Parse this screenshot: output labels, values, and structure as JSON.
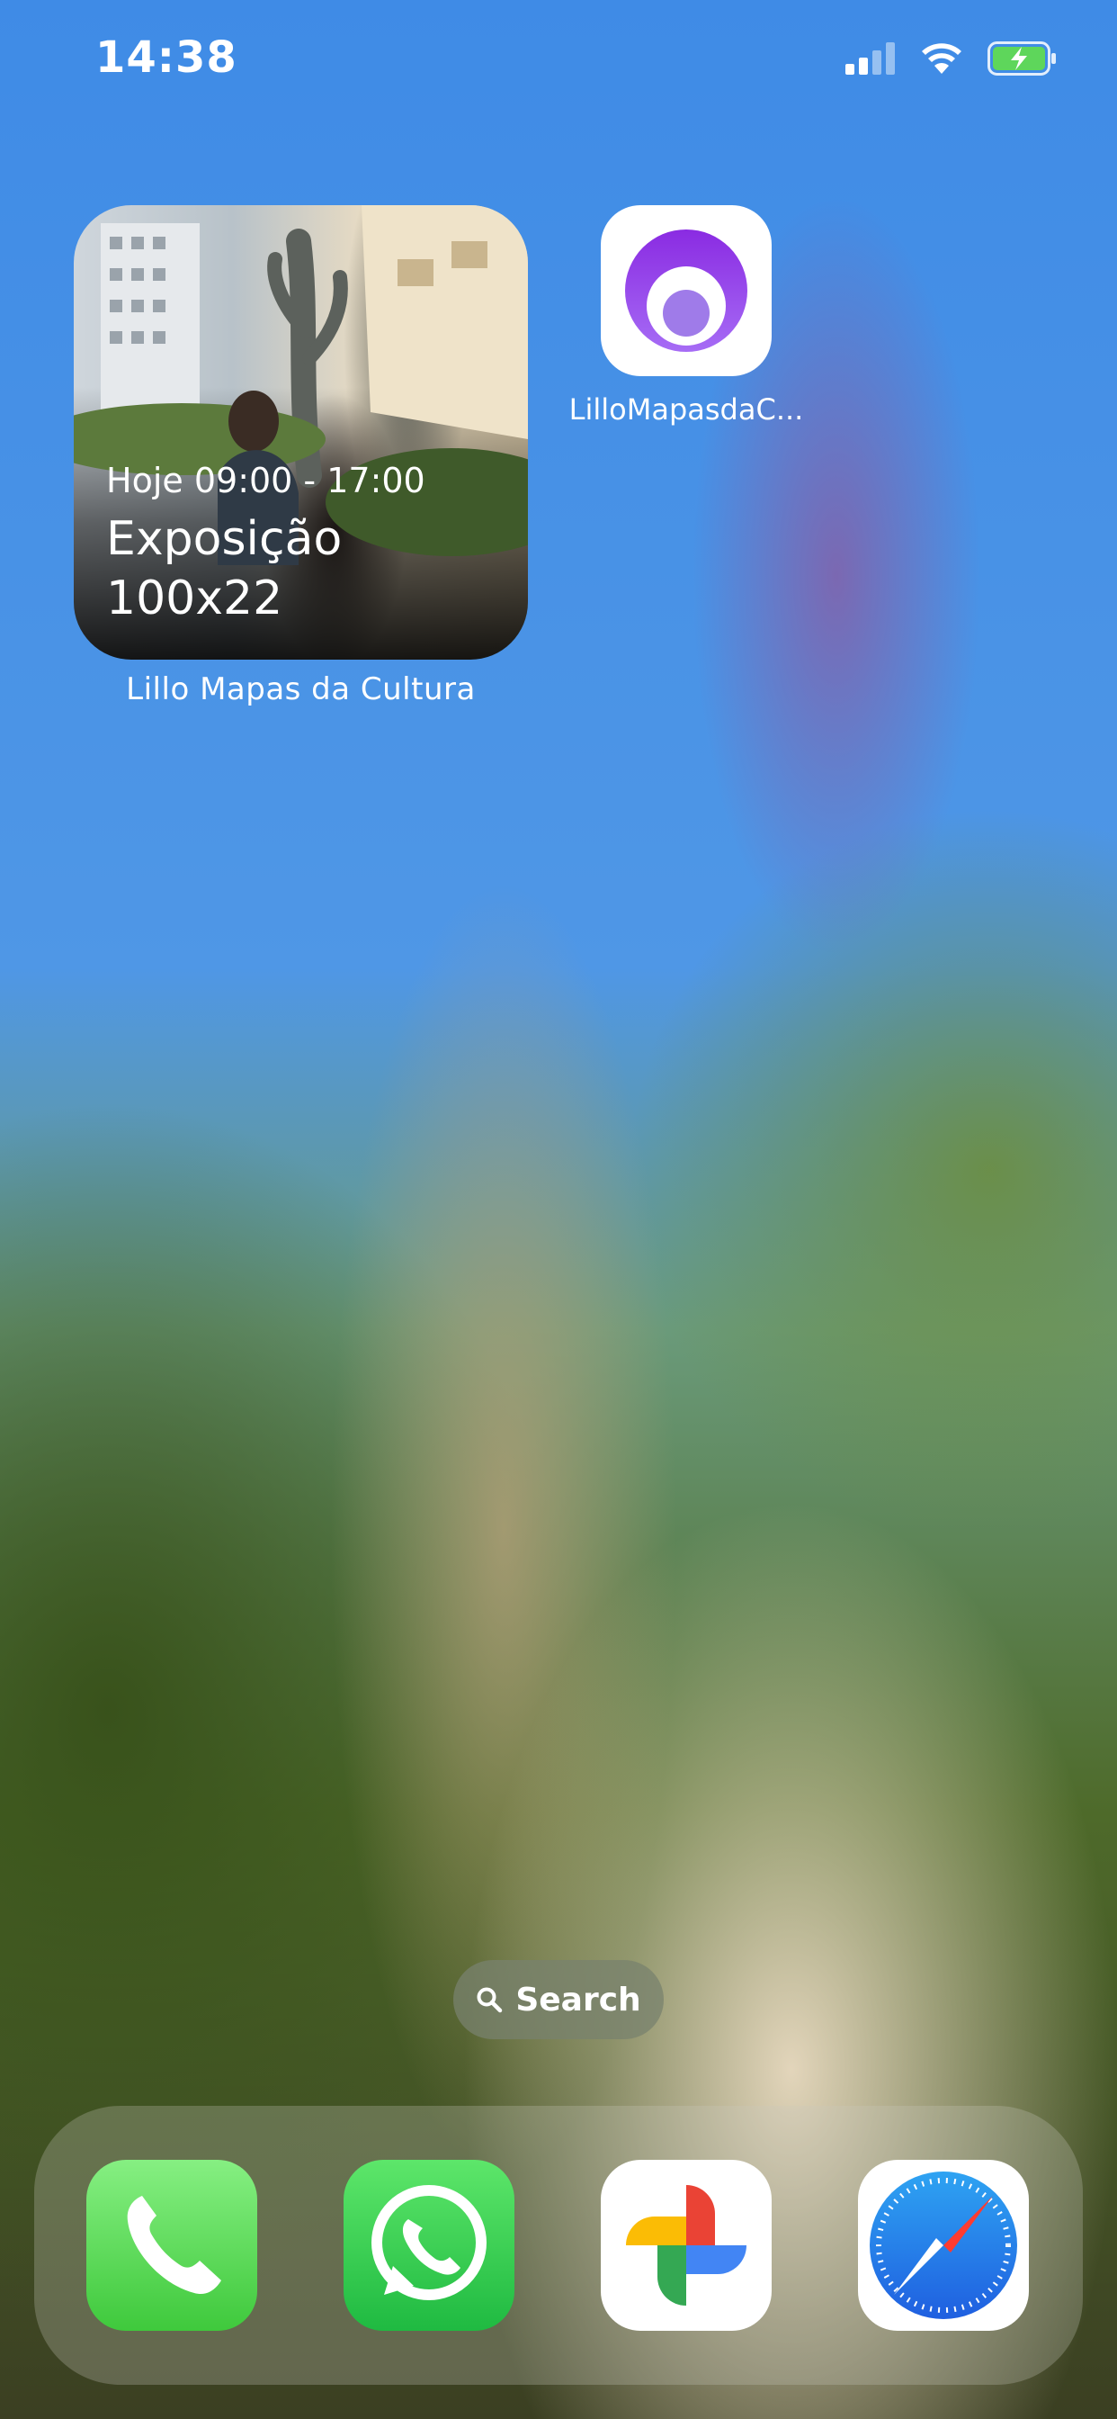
{
  "status_bar": {
    "time": "14:38",
    "icons": [
      "signal-icon",
      "wifi-icon",
      "battery-charging-icon"
    ]
  },
  "widget": {
    "hours": "Hoje 09:00 - 17:00",
    "title": "Exposição 100x22",
    "label": "Lillo Mapas da Cultura"
  },
  "apps": {
    "lillo_label": "LilloMapasdaC..."
  },
  "search": {
    "label": "Search",
    "icon": "search-icon"
  },
  "dock": {
    "items": [
      "phone-app-icon",
      "whatsapp-app-icon",
      "photos-app-icon",
      "safari-app-icon"
    ]
  },
  "colors": {
    "phone_green": "#4cd964",
    "whatsapp_green": "#25d366",
    "lillo_purple": "#8a3ff0",
    "safari_blue": "#1e88e5"
  }
}
